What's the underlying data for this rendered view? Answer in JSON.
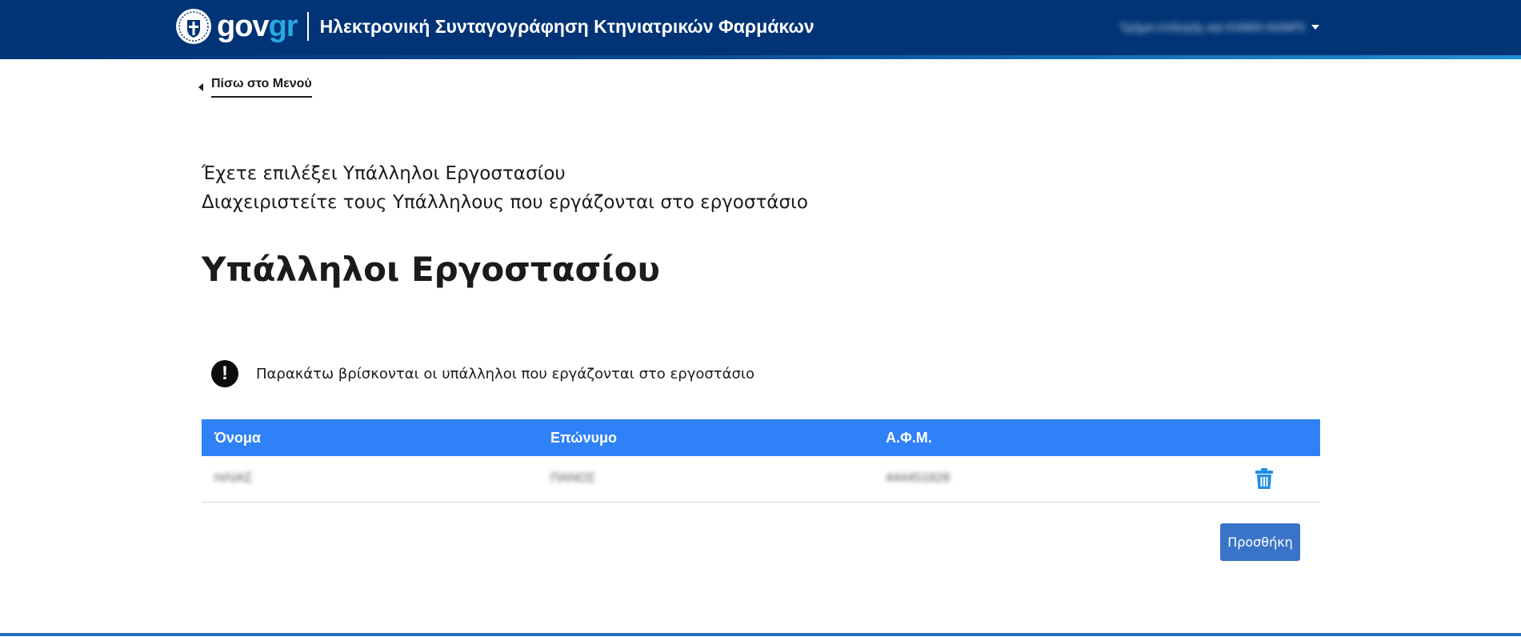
{
  "header": {
    "brand_gov": "gov",
    "brand_gr": "gr",
    "app_title": "Ηλεκτρονική Συνταγογράφηση Κτηνιατρικών Φαρμάκων",
    "user_name": "Τμήμα επιλογής και ΚΑΜΙΑ ΝΑΜΠΙ"
  },
  "nav": {
    "back_label": "Πίσω στο Μενού"
  },
  "intro": {
    "line1": "Έχετε επιλέξει Υπάλληλοι Εργοστασίου",
    "line2": "Διαχειριστείτε τους Υπάλληλους που εργάζονται στο εργοστάσιο"
  },
  "page_title": "Υπάλληλοι Εργοστασίου",
  "notice": {
    "icon": "!",
    "text": "Παρακάτω βρίσκονται οι υπάλληλοι που εργάζονται στο εργοστάσιο"
  },
  "table": {
    "columns": [
      "Όνομα",
      "Επώνυμο",
      "Α.Φ.Μ."
    ],
    "rows": [
      {
        "first_name": "ΗΛΙΑΣ",
        "last_name": "ΠΑΝΟΣ",
        "afm": "444451828"
      }
    ]
  },
  "actions": {
    "add_label": "Προσθήκη"
  },
  "colors": {
    "header_bg": "#003476",
    "table_header_bg": "#2f81f7",
    "button_bg": "#3a74c8",
    "trash_icon": "#1f8ee6"
  }
}
